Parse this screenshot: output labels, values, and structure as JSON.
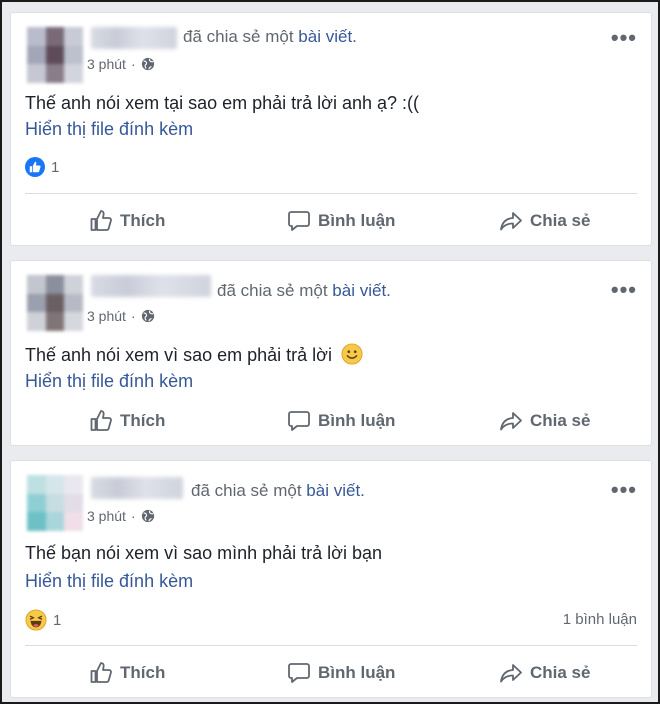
{
  "posts": [
    {
      "header_action": "đã chia sẻ một",
      "header_link": "bài viết.",
      "time": "3 phút",
      "text": "Thế anh nói xem tại sao em phải trả lời anh ạ? :((",
      "attachment_link": "Hiển thị file đính kèm",
      "reaction_icon": "like-icon",
      "reaction_count": "1",
      "comment_count": "",
      "actions": {
        "like": "Thích",
        "comment": "Bình luận",
        "share": "Chia sẻ"
      }
    },
    {
      "header_action": "đã chia sẻ một",
      "header_link": "bài viết.",
      "time": "3 phút",
      "text": "Thế anh nói xem vì sao em phải trả lời",
      "text_emoji": "smile-emoji",
      "attachment_link": "Hiển thị file đính kèm",
      "actions": {
        "like": "Thích",
        "comment": "Bình luận",
        "share": "Chia sẻ"
      }
    },
    {
      "header_action": "đã chia sẻ một",
      "header_link": "bài viết.",
      "time": "3 phút",
      "text": "Thế bạn nói xem vì sao mình phải trả lời bạn",
      "attachment_link": "Hiển thị file đính kèm",
      "reaction_icon": "haha-icon",
      "reaction_count": "1",
      "comment_count": "1 bình luận",
      "actions": {
        "like": "Thích",
        "comment": "Bình luận",
        "share": "Chia sẻ"
      }
    }
  ],
  "colors": {
    "link": "#365899",
    "meta": "#616770",
    "action": "#606770",
    "like_blue": "#1877f2",
    "background": "#e9ebee"
  }
}
